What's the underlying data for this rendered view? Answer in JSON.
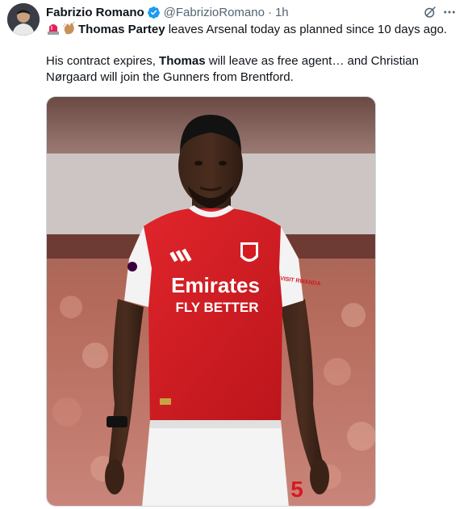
{
  "tweet": {
    "author_name": "Fabrizio Romano",
    "author_handle": "@FabrizioRomano",
    "separator": "·",
    "time": "1h",
    "line1_name": "Thomas Partey",
    "line1_rest": " leaves Arsenal today as planned since 10 days ago.",
    "para2_part1": "His contract expires, ",
    "para2_name": "Thomas",
    "para2_part2": " will leave as free agent… and Christian Nørgaard will join the Gunners from Brentford.",
    "image_alt": "Thomas Partey in an Arsenal home kit on the pitch"
  },
  "kit": {
    "sponsor_line1": "Emirates",
    "sponsor_line2": "FLY BETTER",
    "sleeve_text": "VISIT RWANDA",
    "number": "5"
  },
  "colors": {
    "verified_blue": "#1d9bf0",
    "arsenal_red": "#d71920",
    "text_secondary": "#536471"
  },
  "icons": {
    "verified": "verified-badge-icon",
    "grok": "grok-icon",
    "more": "more-icon",
    "siren": "siren-emoji",
    "clap": "clap-emoji"
  }
}
